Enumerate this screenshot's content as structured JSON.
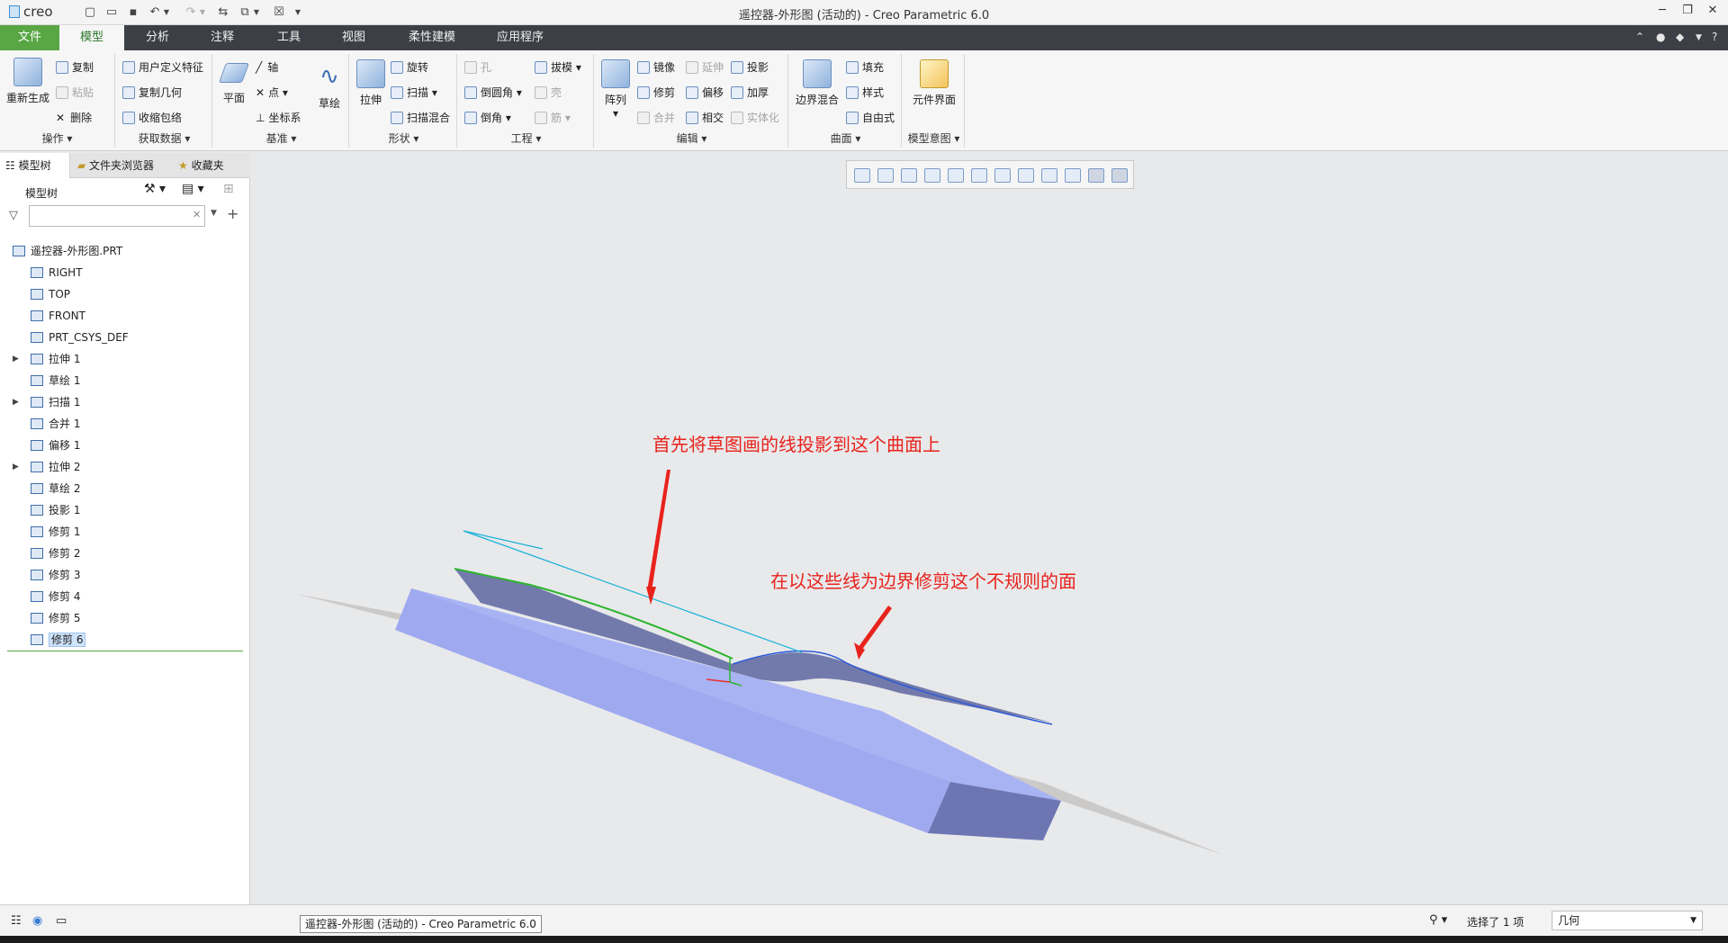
{
  "titlebar": {
    "app_logo": "creo",
    "title": "遥控器-外形图 (活动的) - Creo Parametric 6.0"
  },
  "ribbon_tabs": [
    "文件",
    "模型",
    "分析",
    "注释",
    "工具",
    "视图",
    "柔性建模",
    "应用程序"
  ],
  "ribbon": {
    "operations": {
      "regenerate": "重新生成",
      "copy": "复制",
      "paste": "粘贴",
      "delete": "删除",
      "label": "操作"
    },
    "get_data": {
      "udf": "用户定义特征",
      "copy_geom": "复制几何",
      "shrinkwrap": "收缩包络",
      "label": "获取数据"
    },
    "datum": {
      "plane": "平面",
      "axis": "轴",
      "point": "点",
      "csys": "坐标系",
      "sketch": "草绘",
      "label": "基准"
    },
    "shapes": {
      "extrude": "拉伸",
      "revolve": "旋转",
      "sweep": "扫描",
      "swept_blend": "扫描混合",
      "label": "形状"
    },
    "engineering": {
      "hole": "孔",
      "draft": "拔模",
      "round": "倒圆角",
      "shell": "壳",
      "chamfer": "倒角",
      "rib": "筋",
      "label": "工程"
    },
    "editing": {
      "pattern": "阵列",
      "mirror": "镜像",
      "extend": "延伸",
      "project": "投影",
      "trim": "修剪",
      "offset": "偏移",
      "thicken": "加厚",
      "merge": "合并",
      "intersect": "相交",
      "solidify": "实体化",
      "label": "编辑"
    },
    "surfaces": {
      "boundary_blend": "边界混合",
      "fill": "填充",
      "style": "样式",
      "freestyle": "自由式",
      "label": "曲面"
    },
    "model_intent": {
      "component_interface": "元件界面",
      "label": "模型意图"
    }
  },
  "left_panel": {
    "tabs": [
      "模型树",
      "文件夹浏览器",
      "收藏夹"
    ],
    "header": "模型树",
    "search_placeholder": "",
    "items": [
      {
        "label": "遥控器-外形图.PRT",
        "icon": "part-icon"
      },
      {
        "label": "RIGHT",
        "icon": "datum-plane-icon"
      },
      {
        "label": "TOP",
        "icon": "datum-plane-icon"
      },
      {
        "label": "FRONT",
        "icon": "datum-plane-icon"
      },
      {
        "label": "PRT_CSYS_DEF",
        "icon": "csys-icon"
      },
      {
        "label": "拉伸 1",
        "icon": "extrude-icon"
      },
      {
        "label": "草绘 1",
        "icon": "sketch-icon"
      },
      {
        "label": "扫描 1",
        "icon": "sweep-icon"
      },
      {
        "label": "合并 1",
        "icon": "merge-icon"
      },
      {
        "label": "偏移 1",
        "icon": "offset-icon"
      },
      {
        "label": "拉伸 2",
        "icon": "extrude-icon"
      },
      {
        "label": "草绘 2",
        "icon": "sketch-icon"
      },
      {
        "label": "投影 1",
        "icon": "project-icon"
      },
      {
        "label": "修剪 1",
        "icon": "trim-icon"
      },
      {
        "label": "修剪 2",
        "icon": "trim-icon"
      },
      {
        "label": "修剪 3",
        "icon": "trim-icon"
      },
      {
        "label": "修剪 4",
        "icon": "trim-icon"
      },
      {
        "label": "修剪 5",
        "icon": "trim-icon"
      },
      {
        "label": "修剪 6",
        "icon": "trim-icon"
      }
    ]
  },
  "annotations": {
    "first": "首先将草图画的线投影到这个曲面上",
    "second": "在以这些线为边界修剪这个不规则的面"
  },
  "statusbar": {
    "tooltip": "遥控器-外形图 (活动的) - Creo Parametric 6.0",
    "selection": "选择了 1 项",
    "filter": "几何"
  },
  "colors": {
    "file_tab": "#58a644",
    "tabs_bar": "#3c3f45",
    "annotation": "#e8231c",
    "model_fill": "#a8b3f4"
  }
}
